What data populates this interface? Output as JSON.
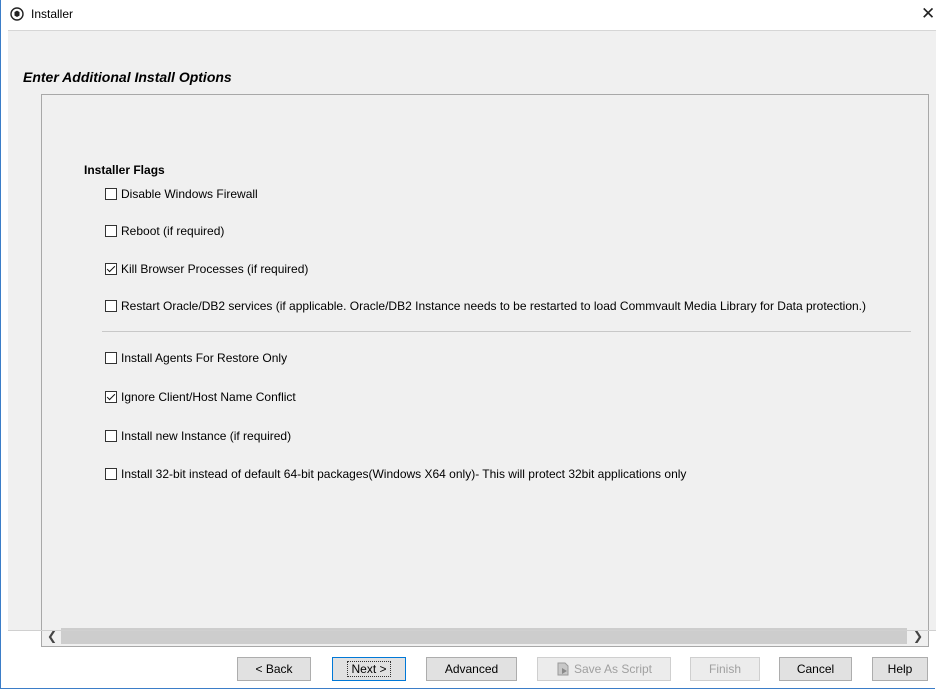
{
  "window": {
    "title": "Installer"
  },
  "heading": "Enter Additional Install Options",
  "group": {
    "title": "Installer Flags"
  },
  "options": [
    {
      "label": "Disable Windows Firewall",
      "checked": false
    },
    {
      "label": "Reboot (if required)",
      "checked": false
    },
    {
      "label": "Kill Browser Processes (if required)",
      "checked": true
    },
    {
      "label": "Restart Oracle/DB2 services (if applicable. Oracle/DB2 Instance needs to be restarted to load Commvault Media Library for Data protection.)",
      "checked": false
    },
    {
      "label": "Install Agents For Restore Only",
      "checked": false
    },
    {
      "label": "Ignore Client/Host Name Conflict",
      "checked": true
    },
    {
      "label": "Install new Instance (if required)",
      "checked": false
    },
    {
      "label": "Install 32-bit instead of default 64-bit packages(Windows X64 only)- This will protect 32bit applications only",
      "checked": false
    }
  ],
  "buttons": {
    "back": "< Back",
    "next": "Next >",
    "advanced": "Advanced",
    "save_script": "Save As Script",
    "finish": "Finish",
    "cancel": "Cancel",
    "help": "Help"
  },
  "icons": {
    "app": "installer-app-icon",
    "close": "close-icon",
    "scroll_left": "chevron-left-icon",
    "scroll_right": "chevron-right-icon",
    "save_script": "script-icon"
  }
}
